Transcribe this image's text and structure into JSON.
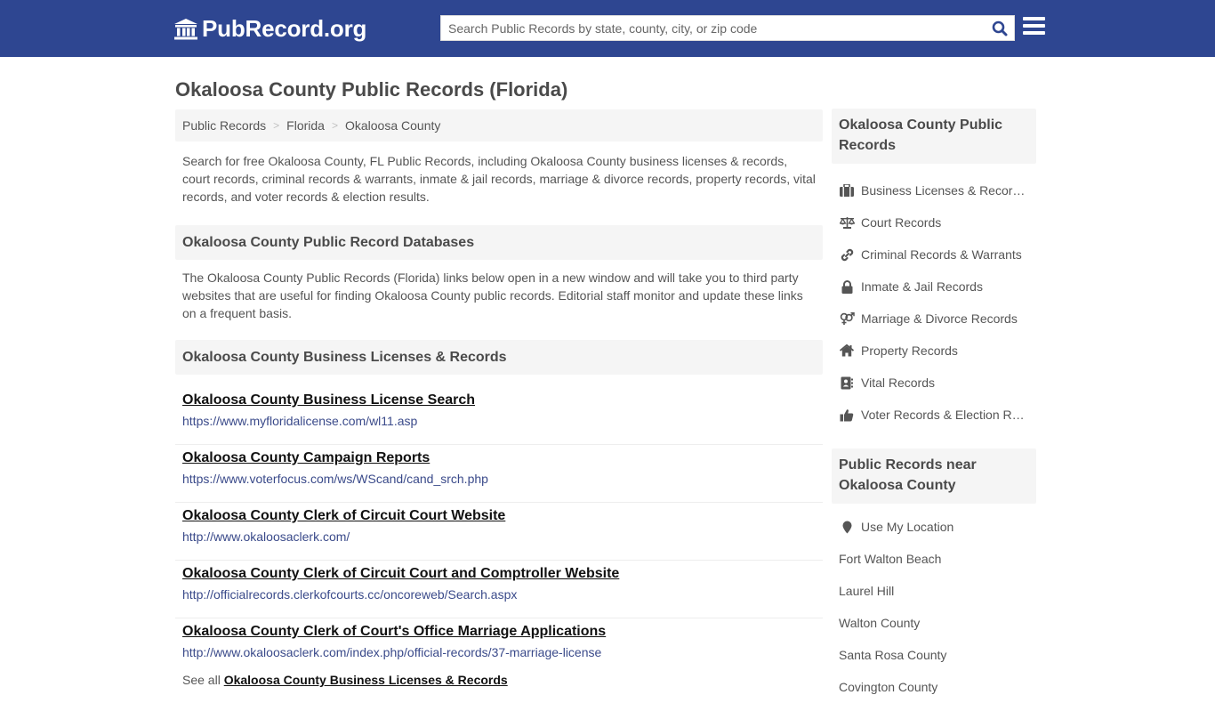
{
  "header": {
    "logo_text": "PubRecord.org",
    "search_placeholder": "Search Public Records by state, county, city, or zip code",
    "brand_color": "#2e4691"
  },
  "main": {
    "title": "Okaloosa County Public Records (Florida)",
    "breadcrumb": [
      "Public Records",
      "Florida",
      "Okaloosa County"
    ],
    "breadcrumb_separator": ">",
    "intro": "Search for free Okaloosa County, FL Public Records, including Okaloosa County business licenses & records, court records, criminal records & warrants, inmate & jail records, marriage & divorce records, property records, vital records, and voter records & election results.",
    "databases_heading": "Okaloosa County Public Record Databases",
    "databases_desc": "The Okaloosa County Public Records (Florida) links below open in a new window and will take you to third party websites that are useful for finding Okaloosa County public records. Editorial staff monitor and update these links on a frequent basis.",
    "business_heading": "Okaloosa County Business Licenses & Records",
    "links": [
      {
        "title": "Okaloosa County Business License Search",
        "url": "https://www.myfloridalicense.com/wl11.asp"
      },
      {
        "title": "Okaloosa County Campaign Reports",
        "url": "https://www.voterfocus.com/ws/WScand/cand_srch.php"
      },
      {
        "title": "Okaloosa County Clerk of Circuit Court Website",
        "url": "http://www.okaloosaclerk.com/"
      },
      {
        "title": "Okaloosa County Clerk of Circuit Court and Comptroller Website",
        "url": "http://officialrecords.clerkofcourts.cc/oncoreweb/Search.aspx"
      },
      {
        "title": "Okaloosa County Clerk of Court's Office Marriage Applications",
        "url": "http://www.okaloosaclerk.com/index.php/official-records/37-marriage-license"
      }
    ],
    "see_all_prefix": "See all",
    "see_all_link": "Okaloosa County Business Licenses & Records"
  },
  "sidebar": {
    "records_heading": "Okaloosa County Public Records",
    "records": [
      {
        "icon": "briefcase-icon",
        "label": "Business Licenses & Records"
      },
      {
        "icon": "scale-icon",
        "label": "Court Records"
      },
      {
        "icon": "link-icon",
        "label": "Criminal Records & Warrants"
      },
      {
        "icon": "lock-icon",
        "label": "Inmate & Jail Records"
      },
      {
        "icon": "gender-icon",
        "label": "Marriage & Divorce Records"
      },
      {
        "icon": "home-icon",
        "label": "Property Records"
      },
      {
        "icon": "address-book-icon",
        "label": "Vital Records"
      },
      {
        "icon": "thumbs-up-icon",
        "label": "Voter Records & Election Results"
      }
    ],
    "near_heading": "Public Records near Okaloosa County",
    "use_location": "Use My Location",
    "near": [
      "Fort Walton Beach",
      "Laurel Hill",
      "Walton County",
      "Santa Rosa County",
      "Covington County"
    ]
  }
}
